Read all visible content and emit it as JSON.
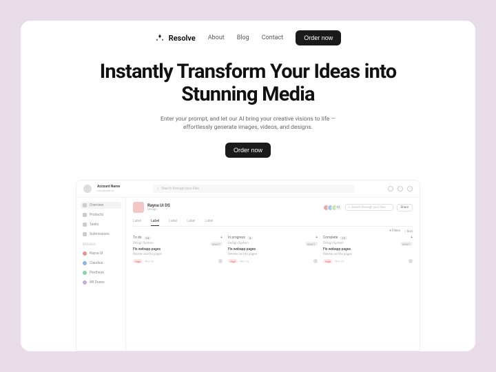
{
  "brand": "Resolve",
  "nav": {
    "about": "About",
    "blog": "Blog",
    "contact": "Contact",
    "cta": "Order now"
  },
  "hero": {
    "title": "Instantly Transform Your Ideas into Stunning Media",
    "subtitle": "Enter your prompt, and let our AI bring your creative visions to life — effortlessly generate images, videos, and designs.",
    "cta": "Order now"
  },
  "dashboard": {
    "search_placeholder": "Search through your files",
    "sidebar": {
      "overview": "Overview",
      "products": "Products",
      "tasks": "Tasks",
      "submissions": "Submissions",
      "brands_heading": "Brands",
      "brands": [
        {
          "name": "Rayna UI",
          "color": "#e89090"
        },
        {
          "name": "Claudius",
          "color": "#8ab4e8"
        },
        {
          "name": "Pentheon",
          "color": "#8ad4a8"
        },
        {
          "name": "AB Dunes",
          "color": "#c8a8e8"
        }
      ]
    },
    "project": {
      "name": "Rayna UI DS",
      "subtitle": "Design"
    },
    "avatars_more": "+2",
    "mini_search": "Search through your files",
    "share": "Share",
    "tabs": [
      "Label",
      "Label",
      "Label",
      "Label",
      "Label"
    ],
    "view": {
      "filters": "Filters",
      "sort": "Sort"
    },
    "columns": [
      {
        "title": "To do",
        "count": "14"
      },
      {
        "title": "In progress",
        "count": "3"
      },
      {
        "title": "Complete",
        "count": "12"
      }
    ],
    "card": {
      "section": "Design System",
      "status": "DRAFT",
      "title": "Fix webapp pages",
      "desc": "Review and fix pages",
      "priority": "High",
      "date": "Nov 23"
    }
  }
}
